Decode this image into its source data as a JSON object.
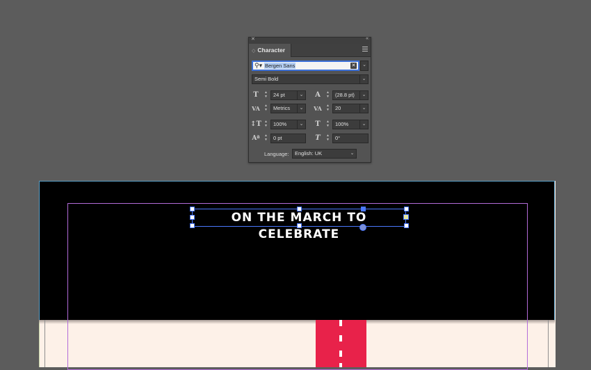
{
  "panel": {
    "title": "Character",
    "font_family": "Bergen Sans",
    "font_style": "Semi Bold",
    "font_size": "24 pt",
    "leading": "(28.8 pt)",
    "kerning": "Metrics",
    "tracking": "20",
    "vertical_scale": "100%",
    "horizontal_scale": "100%",
    "baseline_shift": "0 pt",
    "skew": "0°",
    "language_label": "Language:",
    "language_value": "English: UK"
  },
  "document": {
    "headline": "ON THE MARCH TO CELEBRATE",
    "background_color": "#000000",
    "page_color": "#fdf1e8",
    "road_color": "#e8224a",
    "selection_color": "#4a78ff"
  }
}
